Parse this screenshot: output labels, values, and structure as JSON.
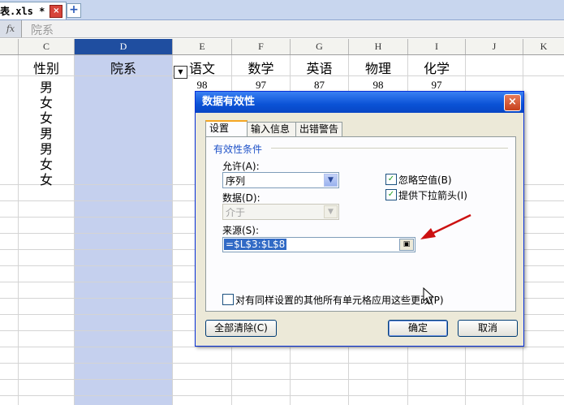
{
  "tab": {
    "filename": "表.xls *",
    "close_glyph": "×",
    "new_glyph": "+"
  },
  "formula": {
    "fx_label": "fx",
    "content": "院系"
  },
  "columns": [
    "C",
    "D",
    "E",
    "F",
    "G",
    "H",
    "I",
    "J",
    "K"
  ],
  "header_row": {
    "gender": "性别",
    "department": "院系",
    "chinese": "语文",
    "math": "数学",
    "english": "英语",
    "physics": "物理",
    "chemistry": "化学"
  },
  "gender_values": [
    "男",
    "女",
    "女",
    "男",
    "男",
    "女",
    "女"
  ],
  "first_scores": [
    "98",
    "97",
    "87",
    "98",
    "97"
  ],
  "dialog": {
    "title": "数据有效性",
    "close_glyph": "×",
    "tabs": [
      "设置",
      "输入信息",
      "出错警告"
    ],
    "group_label": "有效性条件",
    "allow_label": "允许(A):",
    "allow_value": "序列",
    "data_label": "数据(D):",
    "data_value": "介于",
    "source_label": "来源(S):",
    "source_value": "=$L$3:$L$8",
    "ignore_blank_label": "忽略空值(B)",
    "dropdown_label": "提供下拉箭头(I)",
    "apply_all_label": "对有同样设置的其他所有单元格应用这些更改(P)",
    "clear_all_label": "全部清除(C)",
    "ok_label": "确定",
    "cancel_label": "取消"
  },
  "colors": {
    "selection": "#c5d0ee",
    "title_bar": "#0a52d6",
    "annotation_arrow": "#cc1111"
  }
}
